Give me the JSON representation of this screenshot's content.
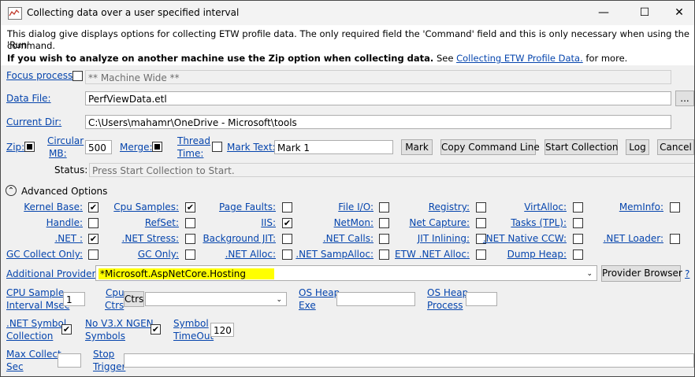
{
  "window": {
    "title": "Collecting data over a user specified interval",
    "minimize_glyph": "—",
    "maximize_glyph": "☐",
    "close_glyph": "✕"
  },
  "info": {
    "line1": "This dialog give displays options for collecting ETW profile data. The only required field the 'Command' field and this is only necessary when using the 'Run'",
    "line2": "command.",
    "bold_text": "If you wish to analyze on another machine use the Zip option when collecting data.",
    "see_text": " See ",
    "link_text": "Collecting ETW Profile Data.",
    "more_text": " for more."
  },
  "focus_process": {
    "label": "Focus process:",
    "value": "** Machine Wide **",
    "checked": false
  },
  "data_file": {
    "label": "Data File:",
    "value": "PerfViewData.etl",
    "browse": "..."
  },
  "current_dir": {
    "label": "Current Dir:",
    "value": "C:\\Users\\mahamr\\OneDrive - Microsoft\\tools"
  },
  "options_row": {
    "zip": "Zip:",
    "zip_checked": true,
    "circular_1": "Circular",
    "circular_2": "MB:",
    "circular_value": "500",
    "merge": "Merge:",
    "merge_checked": true,
    "thread_1": "Thread",
    "thread_2": "Time:",
    "thread_checked": false,
    "mark_text_label": "Mark Text:",
    "mark_text_value": "Mark 1",
    "mark_button": "Mark",
    "copy_button": "Copy Command Line",
    "start_button": "Start Collection",
    "log_button": "Log",
    "cancel_button": "Cancel"
  },
  "status": {
    "label": "Status:",
    "value": "Press Start Collection to Start."
  },
  "advanced": {
    "toggle_glyph": "⌃",
    "label": "Advanced Options"
  },
  "grid": [
    [
      {
        "label": "Kernel Base:",
        "checked": true
      },
      {
        "label": "Cpu Samples:",
        "checked": true
      },
      {
        "label": "Page Faults:",
        "checked": false
      },
      {
        "label": "File I/O:",
        "checked": false
      },
      {
        "label": "Registry:",
        "checked": false
      },
      {
        "label": "VirtAlloc:",
        "checked": false
      },
      {
        "label": "MemInfo:",
        "checked": false
      }
    ],
    [
      {
        "label": "Handle:",
        "checked": false
      },
      {
        "label": "RefSet:",
        "checked": false
      },
      {
        "label": "IIS:",
        "checked": true
      },
      {
        "label": "NetMon:",
        "checked": false
      },
      {
        "label": "Net Capture:",
        "checked": false
      },
      {
        "label": "Tasks (TPL):",
        "checked": false
      }
    ],
    [
      {
        "label": ".NET :",
        "checked": true
      },
      {
        "label": ".NET Stress:",
        "checked": false
      },
      {
        "label": "Background JIT:",
        "checked": false
      },
      {
        "label": ".NET Calls:",
        "checked": false
      },
      {
        "label": "JIT Inlining:",
        "checked": false
      },
      {
        "label": ".NET Native CCW:",
        "checked": false
      },
      {
        "label": ".NET Loader:",
        "checked": false
      }
    ],
    [
      {
        "label": "GC Collect Only:",
        "checked": false
      },
      {
        "label": "GC Only:",
        "checked": false
      },
      {
        "label": ".NET Alloc:",
        "checked": false
      },
      {
        "label": ".NET SampAlloc:",
        "checked": false
      },
      {
        "label": "ETW .NET Alloc:",
        "checked": false
      },
      {
        "label": "Dump Heap:",
        "checked": false
      }
    ]
  ],
  "providers": {
    "label": "Additional Providers:",
    "value": "*Microsoft.AspNetCore.Hosting",
    "highlight": "#ffff00",
    "browser_button": "Provider Browser",
    "help": "?"
  },
  "cpu_row": {
    "interval_1": "CPU Sample",
    "interval_2": "Interval Msec",
    "interval_value": "1",
    "ctrs_1": "Cpu",
    "ctrs_2": "Ctrs",
    "ctrs_button": "Ctrs",
    "ctrs_select": "",
    "os_heap_exe_1": "OS Heap",
    "os_heap_exe_2": "Exe",
    "os_heap_exe_value": "",
    "os_heap_proc_1": "OS Heap",
    "os_heap_proc_2": "Process",
    "os_heap_proc_value": ""
  },
  "symbol_row": {
    "net_symbol_1": ".NET Symbol",
    "net_symbol_2": "Collection",
    "net_symbol_checked": true,
    "ngen_1": "No V3.X NGEN",
    "ngen_2": "Symbols",
    "ngen_checked": true,
    "timeout_1": "Symbol",
    "timeout_2": "TimeOut",
    "timeout_value": "120"
  },
  "last_row": {
    "max_1": "Max Collect",
    "max_2": "Sec",
    "max_value": "",
    "stop_1": "Stop",
    "stop_2": "Trigger",
    "stop_value": ""
  },
  "check_glyph": "✔"
}
